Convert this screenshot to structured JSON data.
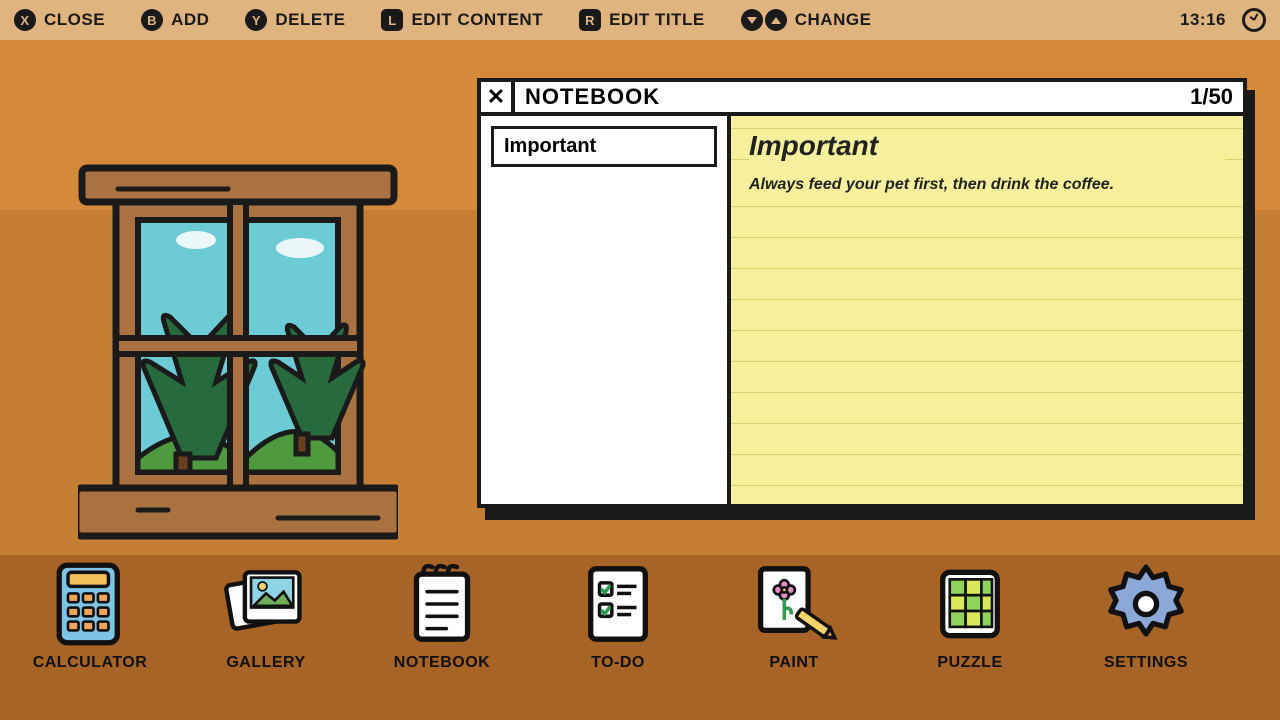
{
  "topbar": {
    "close": {
      "key": "X",
      "label": "CLOSE"
    },
    "add": {
      "key": "B",
      "label": "ADD"
    },
    "delete": {
      "key": "Y",
      "label": "DELETE"
    },
    "editContent": {
      "key": "L",
      "label": "EDIT CONTENT"
    },
    "editTitle": {
      "key": "R",
      "label": "EDIT TITLE"
    },
    "change": {
      "label": "CHANGE"
    },
    "time": "13:16"
  },
  "notebook": {
    "windowTitle": "NOTEBOOK",
    "pageCounter": "1/50",
    "entries": [
      {
        "title": "Important"
      }
    ],
    "current": {
      "title": "Important",
      "content": "Always feed your pet first, then drink the coffee."
    }
  },
  "dock": {
    "items": [
      {
        "label": "CALCULATOR"
      },
      {
        "label": "GALLERY"
      },
      {
        "label": "NOTEBOOK"
      },
      {
        "label": "TO-DO"
      },
      {
        "label": "PAINT"
      },
      {
        "label": "PUZZLE"
      },
      {
        "label": "SETTINGS"
      }
    ]
  }
}
